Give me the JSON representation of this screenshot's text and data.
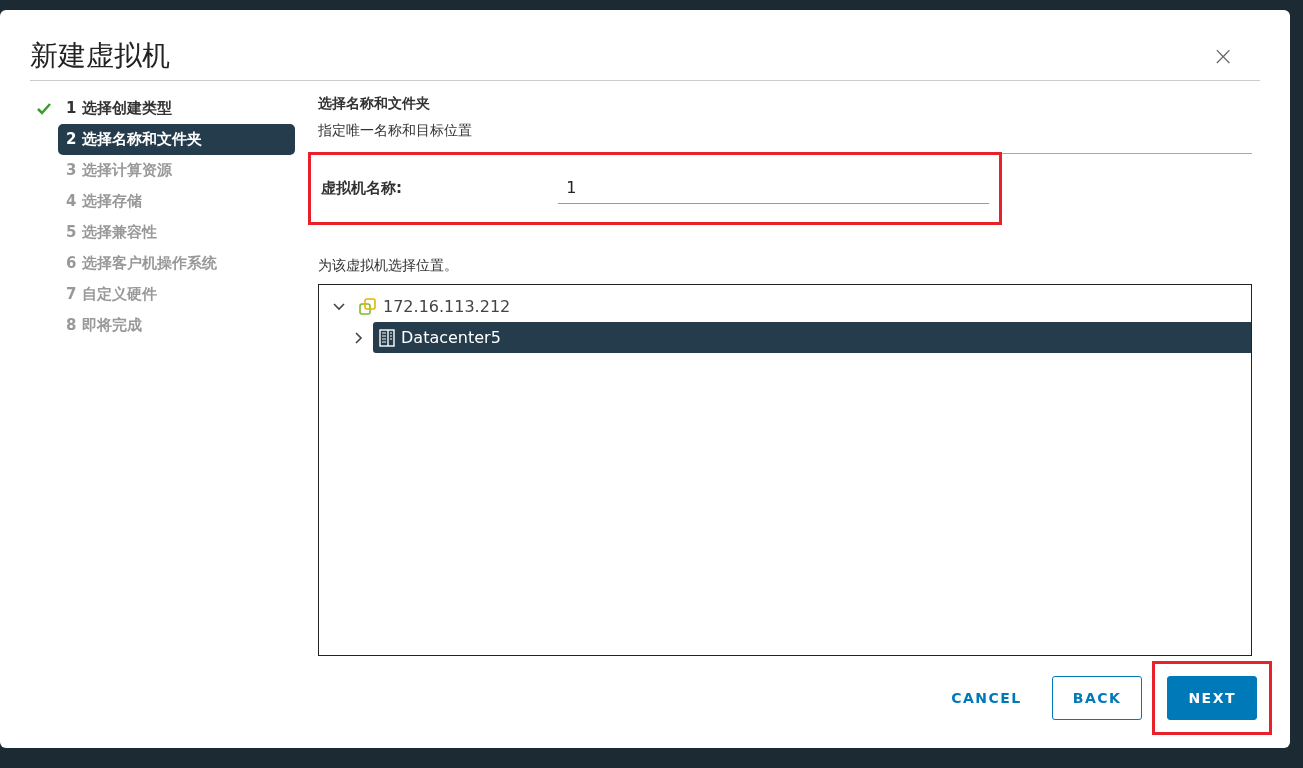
{
  "dialog": {
    "title": "新建虚拟机",
    "close": "×"
  },
  "steps": [
    {
      "label": "1 选择创建类型",
      "completed": true,
      "selected": false,
      "disabled": false
    },
    {
      "label": "2 选择名称和文件夹",
      "completed": false,
      "selected": true,
      "disabled": false
    },
    {
      "label": "3 选择计算资源",
      "completed": false,
      "selected": false,
      "disabled": true
    },
    {
      "label": "4 选择存储",
      "completed": false,
      "selected": false,
      "disabled": true
    },
    {
      "label": "5 选择兼容性",
      "completed": false,
      "selected": false,
      "disabled": true
    },
    {
      "label": "6 选择客户机操作系统",
      "completed": false,
      "selected": false,
      "disabled": true
    },
    {
      "label": "7 自定义硬件",
      "completed": false,
      "selected": false,
      "disabled": true
    },
    {
      "label": "8 即将完成",
      "completed": false,
      "selected": false,
      "disabled": true
    }
  ],
  "page": {
    "heading": "选择名称和文件夹",
    "subheading": "指定唯一名称和目标位置"
  },
  "name_field": {
    "label": "虚拟机名称:",
    "value": "1",
    "highlighted": true
  },
  "location": {
    "label": "为该虚拟机选择位置。",
    "tree": [
      {
        "label": "172.16.113.212",
        "kind": "vcenter",
        "expanded": true,
        "selected": false,
        "children": [
          {
            "label": "Datacenter5",
            "kind": "datacenter",
            "expanded": false,
            "selected": true
          }
        ]
      }
    ]
  },
  "buttons": [
    {
      "label": "CANCEL",
      "kind": "flat",
      "highlighted": false
    },
    {
      "label": "BACK",
      "kind": "outline",
      "highlighted": false
    },
    {
      "label": "NEXT",
      "kind": "primary",
      "highlighted": true
    }
  ]
}
